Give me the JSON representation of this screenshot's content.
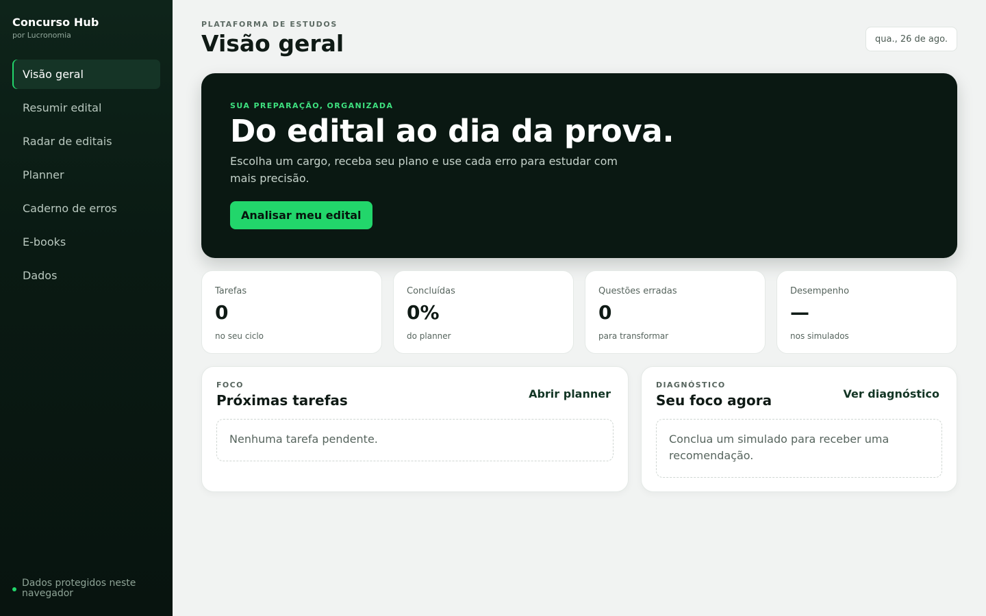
{
  "sidebar": {
    "brand": "Concurso Hub",
    "brand_sub": "por Lucronomia",
    "items": [
      {
        "label": "Visão geral",
        "active": true
      },
      {
        "label": "Resumir edital",
        "active": false
      },
      {
        "label": "Radar de editais",
        "active": false
      },
      {
        "label": "Planner",
        "active": false
      },
      {
        "label": "Caderno de erros",
        "active": false
      },
      {
        "label": "E-books",
        "active": false
      },
      {
        "label": "Dados",
        "active": false
      }
    ],
    "footer": "Dados protegidos neste navegador"
  },
  "header": {
    "eyebrow": "PLATAFORMA DE ESTUDOS",
    "title": "Visão geral",
    "date": "qua., 26 de ago."
  },
  "hero": {
    "eyebrow": "SUA PREPARAÇÃO, ORGANIZADA",
    "title": "Do edital ao dia da prova.",
    "description": "Escolha um cargo, receba seu plano e use cada erro para estudar com mais precisão.",
    "button": "Analisar meu edital"
  },
  "stats": [
    {
      "label": "Tarefas",
      "value": "0",
      "note": "no seu ciclo"
    },
    {
      "label": "Concluídas",
      "value": "0%",
      "note": "do planner"
    },
    {
      "label": "Questões erradas",
      "value": "0",
      "note": "para transformar"
    },
    {
      "label": "Desempenho",
      "value": "—",
      "note": "nos simulados"
    }
  ],
  "panels": {
    "tasks": {
      "eyebrow": "FOCO",
      "title": "Próximas tarefas",
      "link": "Abrir planner",
      "empty": "Nenhuma tarefa pendente."
    },
    "diagnosis": {
      "eyebrow": "DIAGNÓSTICO",
      "title": "Seu foco agora",
      "link": "Ver diagnóstico",
      "empty": "Conclua um simulado para receber uma recomendação."
    }
  },
  "colors": {
    "accent": "#22d66b",
    "sidebar_bg": "#0a1a13",
    "hero_bg": "#0a1812",
    "page_bg": "#f1f3f2"
  }
}
